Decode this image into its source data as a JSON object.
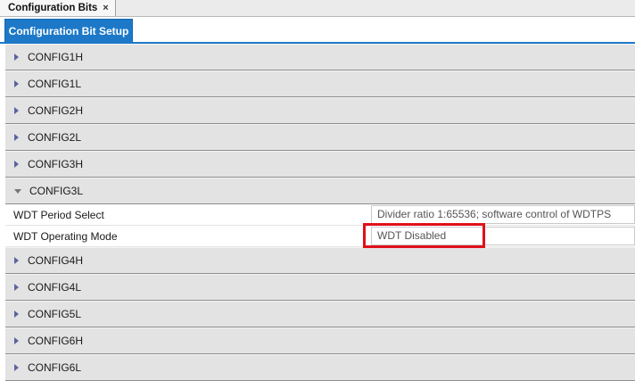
{
  "tabs": {
    "document_tab": "Configuration Bits",
    "close_glyph": "×",
    "view_tab": "Configuration Bit Setup"
  },
  "groups_before": [
    {
      "label": "CONFIG1H",
      "expanded": false
    },
    {
      "label": "CONFIG1L",
      "expanded": false
    },
    {
      "label": "CONFIG2H",
      "expanded": false
    },
    {
      "label": "CONFIG2L",
      "expanded": false
    },
    {
      "label": "CONFIG3H",
      "expanded": false
    }
  ],
  "expanded_group": {
    "label": "CONFIG3L",
    "expanded": true,
    "settings": [
      {
        "name": "WDT Period Select",
        "value": "Divider ratio 1:65536; software control of WDTPS"
      },
      {
        "name": "WDT Operating Mode",
        "value": "WDT Disabled"
      }
    ]
  },
  "groups_after": [
    {
      "label": "CONFIG4H",
      "expanded": false
    },
    {
      "label": "CONFIG4L",
      "expanded": false
    },
    {
      "label": "CONFIG5L",
      "expanded": false
    },
    {
      "label": "CONFIG6H",
      "expanded": false
    },
    {
      "label": "CONFIG6L",
      "expanded": false
    }
  ],
  "annotation": {
    "highlight_color": "#e0101a",
    "highlights": "WDT Operating Mode value"
  },
  "colors": {
    "accent": "#1d79c8",
    "group_bg": "#e3e3e3",
    "expander": "#5a63a0"
  }
}
